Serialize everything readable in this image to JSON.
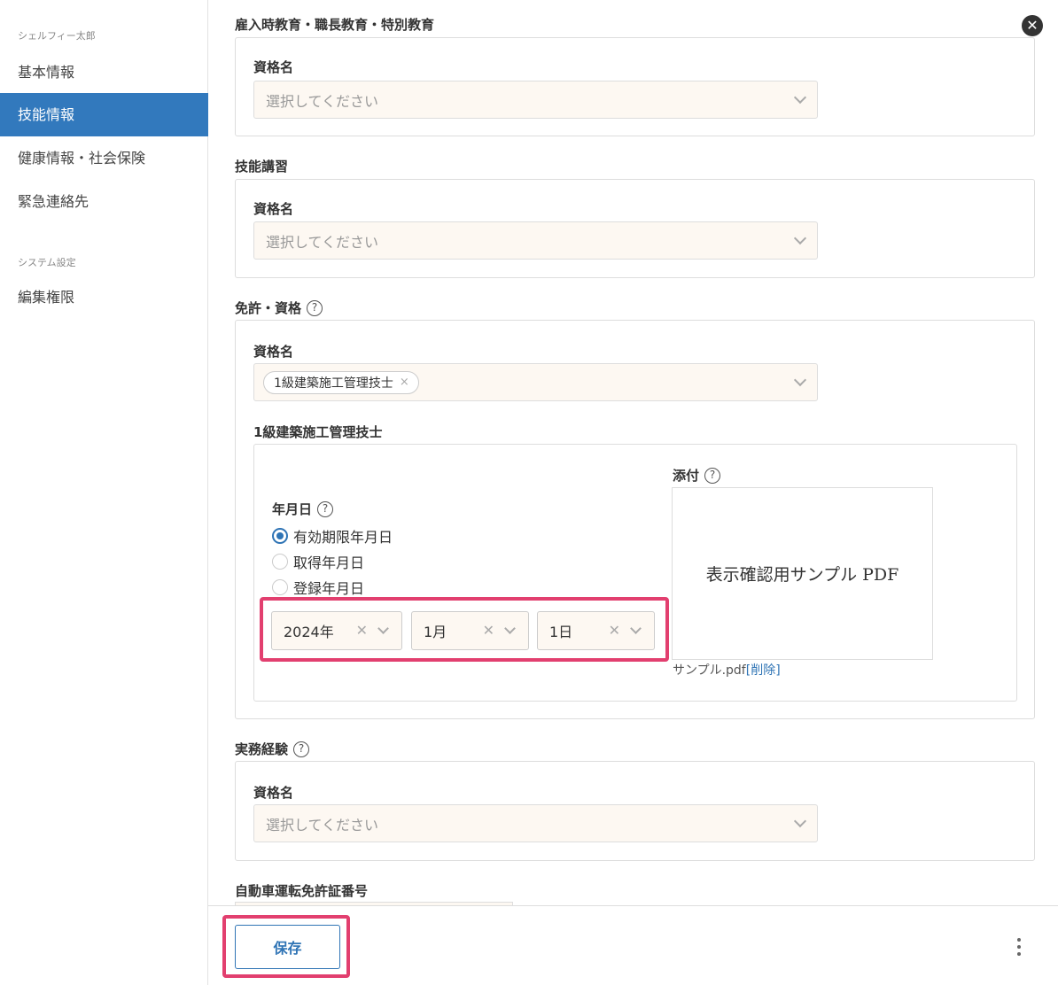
{
  "sidebar": {
    "group1": "シェルフィー太郎",
    "items": [
      {
        "label": "基本情報"
      },
      {
        "label": "技能情報"
      },
      {
        "label": "健康情報・社会保険"
      },
      {
        "label": "緊急連絡先"
      }
    ],
    "group2": "システム設定",
    "items2": [
      {
        "label": "編集権限"
      }
    ]
  },
  "sections": {
    "education": {
      "title": "雇入時教育・職長教育・特別教育",
      "field_label": "資格名",
      "placeholder": "選択してください"
    },
    "training": {
      "title": "技能講習",
      "field_label": "資格名",
      "placeholder": "選択してください"
    },
    "license": {
      "title": "免許・資格",
      "field_label": "資格名",
      "selected_tag": "1級建築施工管理技士",
      "sub_title": "1級建築施工管理技士",
      "date_label": "年月日",
      "radios": [
        {
          "label": "有効期限年月日",
          "checked": true
        },
        {
          "label": "取得年月日",
          "checked": false
        },
        {
          "label": "登録年月日",
          "checked": false
        }
      ],
      "year": "2024年",
      "month": "1月",
      "day": "1日",
      "attach_label": "添付",
      "attach_preview": "表示確認用サンプル PDF",
      "file_name": "サンプル.pdf",
      "delete_link": "[削除]"
    },
    "experience": {
      "title": "実務経験",
      "field_label": "資格名",
      "placeholder": "選択してください"
    },
    "driver": {
      "title": "自動車運転免許証番号"
    }
  },
  "footer": {
    "save_label": "保存"
  },
  "icons": {
    "close": "close-icon",
    "help": "help-icon",
    "more": "more-vertical-icon"
  },
  "colors": {
    "accent": "#3279bd",
    "highlight": "#e23f6f",
    "field_bg": "#fdf8f2"
  }
}
